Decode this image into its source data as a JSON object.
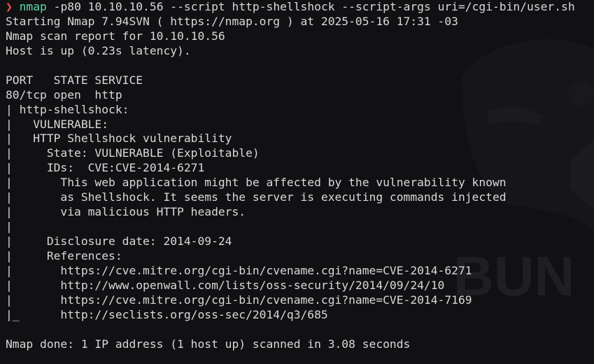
{
  "prompt": {
    "arrow": "❯",
    "command": "nmap",
    "args": "-p80 10.10.10.56 --script http-shellshock --script-args uri=/cgi-bin/user.sh"
  },
  "output": [
    "Starting Nmap 7.94SVN ( https://nmap.org ) at 2025-05-16 17:31 -03",
    "Nmap scan report for 10.10.10.56",
    "Host is up (0.23s latency).",
    "",
    "PORT   STATE SERVICE",
    "80/tcp open  http",
    "| http-shellshock:",
    "|   VULNERABLE:",
    "|   HTTP Shellshock vulnerability",
    "|     State: VULNERABLE (Exploitable)",
    "|     IDs:  CVE:CVE-2014-6271",
    "|       This web application might be affected by the vulnerability known",
    "|       as Shellshock. It seems the server is executing commands injected",
    "|       via malicious HTTP headers.",
    "|",
    "|     Disclosure date: 2014-09-24",
    "|     References:",
    "|       https://cve.mitre.org/cgi-bin/cvename.cgi?name=CVE-2014-6271",
    "|       http://www.openwall.com/lists/oss-security/2014/09/24/10",
    "|       https://cve.mitre.org/cgi-bin/cvename.cgi?name=CVE-2014-7169",
    "|_      http://seclists.org/oss-sec/2014/q3/685",
    "",
    "Nmap done: 1 IP address (1 host up) scanned in 3.08 seconds"
  ],
  "watermark": {
    "text": "BUN",
    "icon": "hacker-skull-icon"
  },
  "colors": {
    "background": "#111114",
    "text": "#d9d9d9",
    "prompt_arrow": "#ff4d4d",
    "command": "#5fd7a7"
  }
}
